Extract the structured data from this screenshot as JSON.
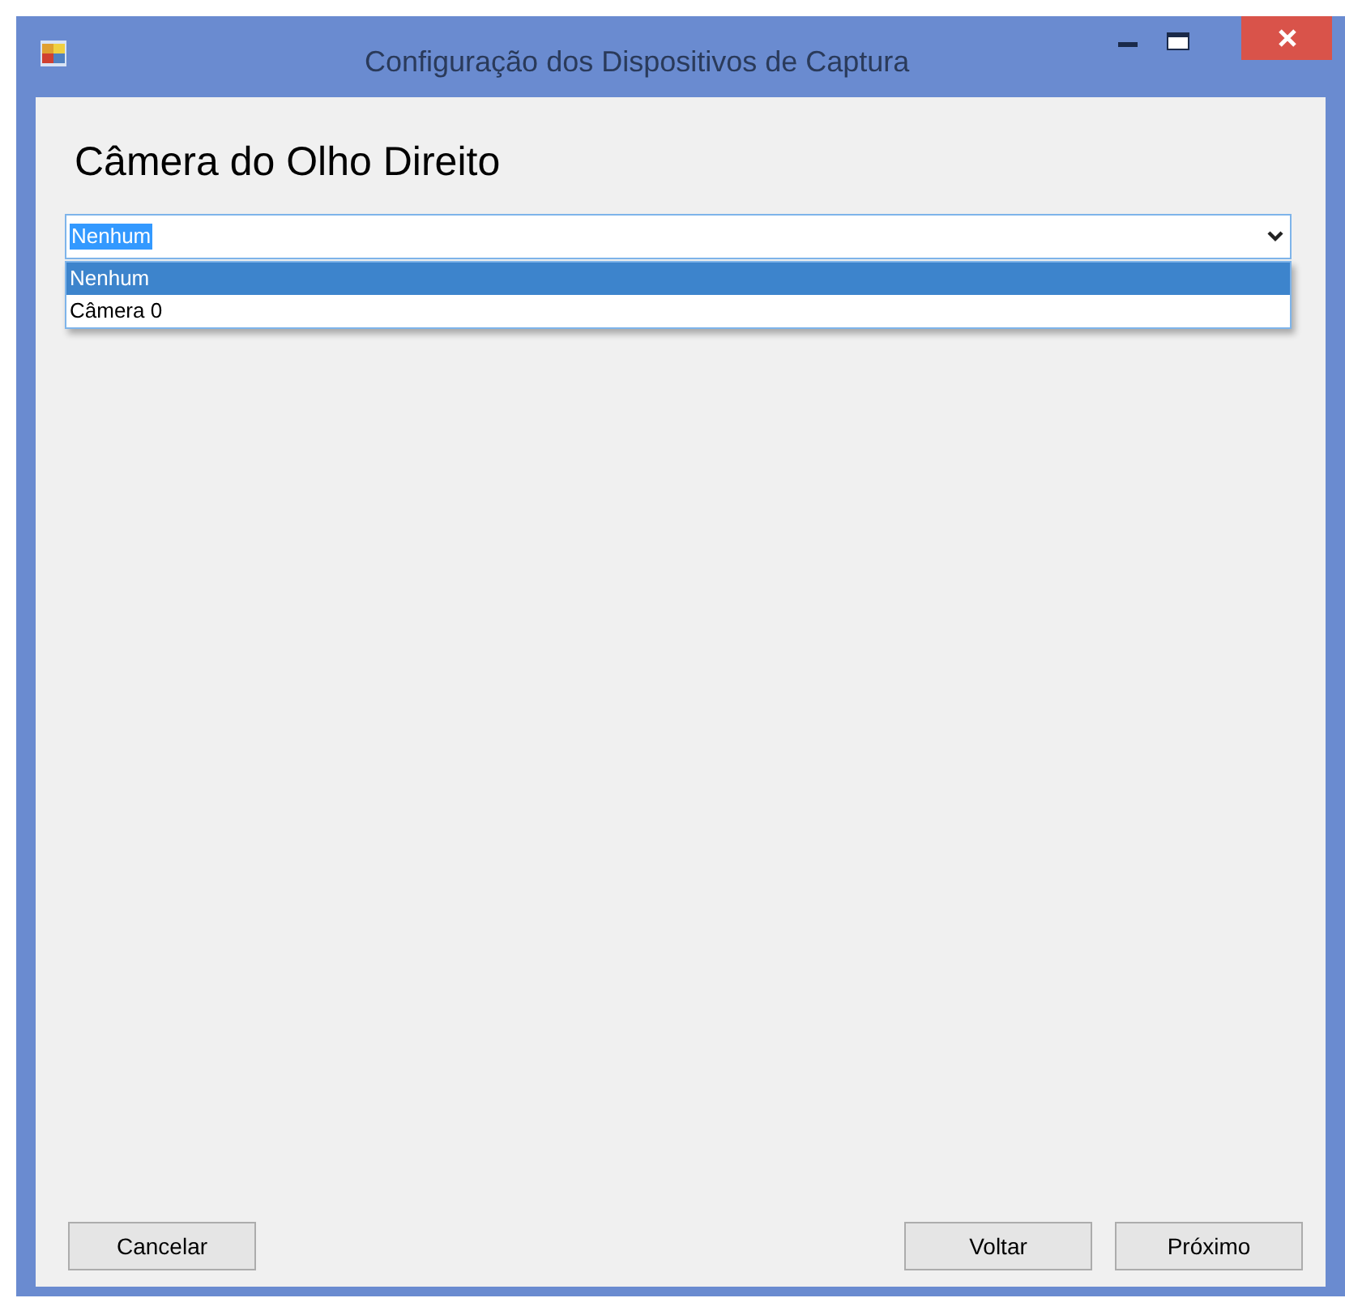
{
  "window": {
    "title": "Configuração dos Dispositivos de Captura"
  },
  "heading": "Câmera do Olho Direito",
  "combo": {
    "value": "Nenhum",
    "expanded": true,
    "options": [
      {
        "label": "Nenhum",
        "selected": true
      },
      {
        "label": "Câmera 0",
        "selected": false
      }
    ]
  },
  "left_buttons": [
    "Cancelar"
  ],
  "right_buttons": [
    "Voltar",
    "Próximo"
  ]
}
